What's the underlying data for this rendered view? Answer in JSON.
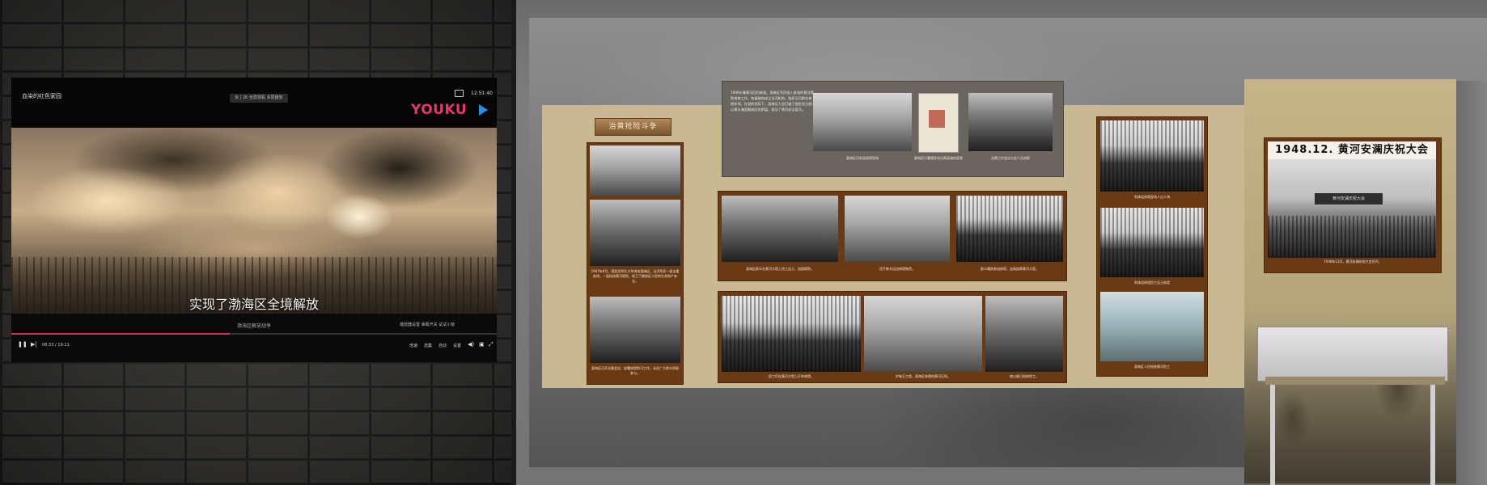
{
  "player": {
    "title": "血染的红色家园",
    "pill_text": "永 | 2K  全屏观看 多屏播放",
    "clock": "12:51:40",
    "logo": "YOUKU",
    "subtitle": "实现了渤海区全境解放",
    "caption_small": "渤海区解放战争",
    "bullet_hint": "播放器设置 弹幕开关 试试小窗",
    "time": "08:33 / 19:11",
    "controls": [
      "倍速",
      "选集",
      "自动",
      "设置"
    ],
    "progress": 0.45,
    "colors": {
      "accent": "#e02a5f",
      "logo_pink": "#e8356f",
      "logo_blue": "#2a8de6"
    }
  },
  "exhibit": {
    "plaque": "治黄抢险斗争",
    "panel_text": "1946年春黄河回归故道，渤海区军民投入紧张的黄河堤防抢修工作。各级政府成立治河机构，组织沿河群众修堤补坝。在党的领导下，渤海区人民打破了国民党企图以黄水淹没解放区的阴谋，保证了黄河安全度汛。",
    "captions": {
      "panel_photo1": "渤海区河务局修堤现场",
      "panel_photo2": "渤海区行署颁发给治黄英雄的奖状",
      "panel_photo3": "治黄工作会议与会人员合影",
      "left_col": "1947年6月，国民党军队大举进攻渤海区，沿河军民一面支援前线，一面抢修黄河堤防，保卫了解放区人民的生命财产安全。",
      "left_col2": "渤海区召开治黄会议，部署修堤防汛工作，动员广大群众积极参与。",
      "mid_row1_a": "渤海区群众在黄河大堤上挖土运土，加固堤防。",
      "mid_row1_b": "用手推车运送修堤物资。",
      "mid_row1_c": "群众踊跃参加修堤，加高加厚黄河大堤。",
      "mid_row2_a": "民工们在黄河大堤上打夯筑堤。",
      "mid_row2_b": "护坡石工程，渤海区修建的黄河石坝。",
      "mid_row2_c": "夜以继日抢修险工。",
      "right_col1": "利津县修堤现场人山人海",
      "right_col2": "利津县修堤民工运土筑堤",
      "right_col3": "渤海区人民抢修黄河险工",
      "celebration_title": "1948.12. 黄河安澜庆祝大会",
      "celebration_stage": "黄河安澜庆祝大会",
      "celebration_cap": "1948年12月，黄河安澜庆祝大会召开。"
    }
  }
}
